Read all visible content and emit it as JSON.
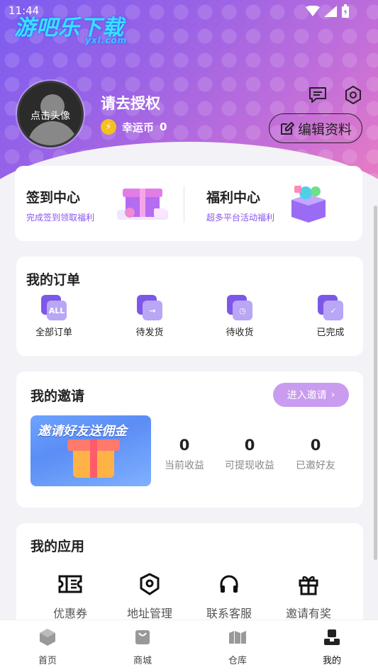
{
  "status_bar": {
    "time": "11:44"
  },
  "watermark": {
    "text": "游吧乐下载",
    "sub": "yxl.com"
  },
  "profile": {
    "avatar_label": "点击头像",
    "username": "请去授权",
    "coin_label": "幸运币",
    "coin_value": "0",
    "edit_label": "编辑资料"
  },
  "welfare": {
    "left": {
      "title": "签到中心",
      "subtitle": "完成签到领取福利"
    },
    "right": {
      "title": "福利中心",
      "subtitle": "超多平台活动福利"
    }
  },
  "orders": {
    "title": "我的订单",
    "items": [
      {
        "label": "全部订单",
        "icon": "all-orders-icon",
        "badge": "ALL"
      },
      {
        "label": "待发货",
        "icon": "to-ship-icon"
      },
      {
        "label": "待收货",
        "icon": "to-receive-icon"
      },
      {
        "label": "已完成",
        "icon": "completed-icon"
      }
    ]
  },
  "invite": {
    "title": "我的邀请",
    "button": "进入邀请",
    "banner_text": "邀请好友送佣金",
    "stats": [
      {
        "value": "0",
        "label": "当前收益"
      },
      {
        "value": "0",
        "label": "可提现收益"
      },
      {
        "value": "0",
        "label": "已邀好友"
      }
    ]
  },
  "apps": {
    "title": "我的应用",
    "items": [
      {
        "label": "优惠券",
        "icon": "coupon-icon"
      },
      {
        "label": "地址管理",
        "icon": "address-icon"
      },
      {
        "label": "联系客服",
        "icon": "headset-icon"
      },
      {
        "label": "邀请有奖",
        "icon": "gift-icon"
      }
    ]
  },
  "tabbar": {
    "items": [
      {
        "label": "首页",
        "icon": "home-icon"
      },
      {
        "label": "商城",
        "icon": "shop-icon"
      },
      {
        "label": "仓库",
        "icon": "warehouse-icon"
      },
      {
        "label": "我的",
        "icon": "profile-icon",
        "active": true
      }
    ]
  },
  "colors": {
    "accent": "#7d58e8",
    "invite_button": "#c99cf0",
    "coin": "#f5c020"
  }
}
